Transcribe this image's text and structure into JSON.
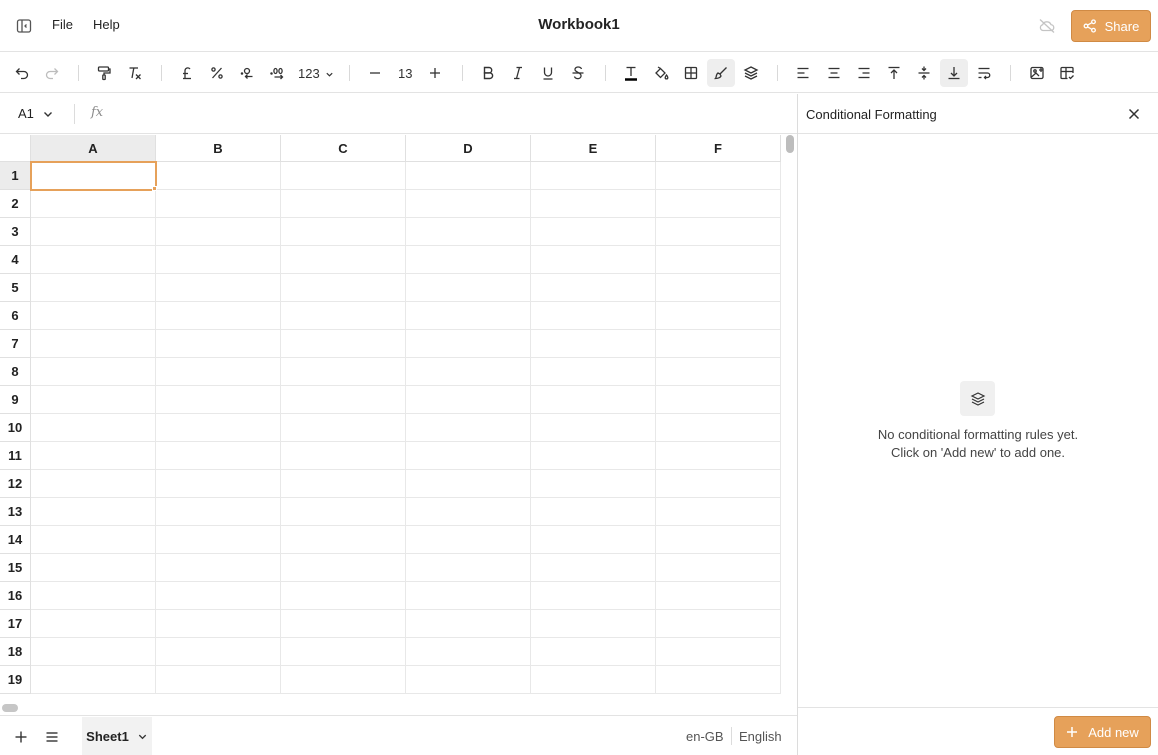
{
  "header": {
    "menu": [
      {
        "label": "File"
      },
      {
        "label": "Help"
      }
    ],
    "title": "Workbook1",
    "share_label": "Share"
  },
  "toolbar": {
    "number_format_label": "123",
    "font_size": "13",
    "active_tools": [
      "format-painter-brush",
      "vertical-align-bottom"
    ]
  },
  "formula_bar": {
    "cell_ref": "A1",
    "fx_label": "fx",
    "value": ""
  },
  "grid": {
    "columns": [
      "A",
      "B",
      "C",
      "D",
      "E",
      "F"
    ],
    "rows": [
      "1",
      "2",
      "3",
      "4",
      "5",
      "6",
      "7",
      "8",
      "9",
      "10",
      "11",
      "12",
      "13",
      "14",
      "15",
      "16",
      "17",
      "18",
      "19"
    ],
    "selected_cell": "A1"
  },
  "footer": {
    "sheets": [
      {
        "label": "Sheet1"
      }
    ],
    "locale": "en-GB",
    "language": "English"
  },
  "panel": {
    "title": "Conditional Formatting",
    "empty_line1": "No conditional formatting rules yet.",
    "empty_line2": "Click on 'Add new' to add one.",
    "add_new_label": "Add new"
  },
  "colors": {
    "accent": "#e6a15a",
    "selection_header": "#ececec",
    "gridline": "#e8e8e8"
  }
}
